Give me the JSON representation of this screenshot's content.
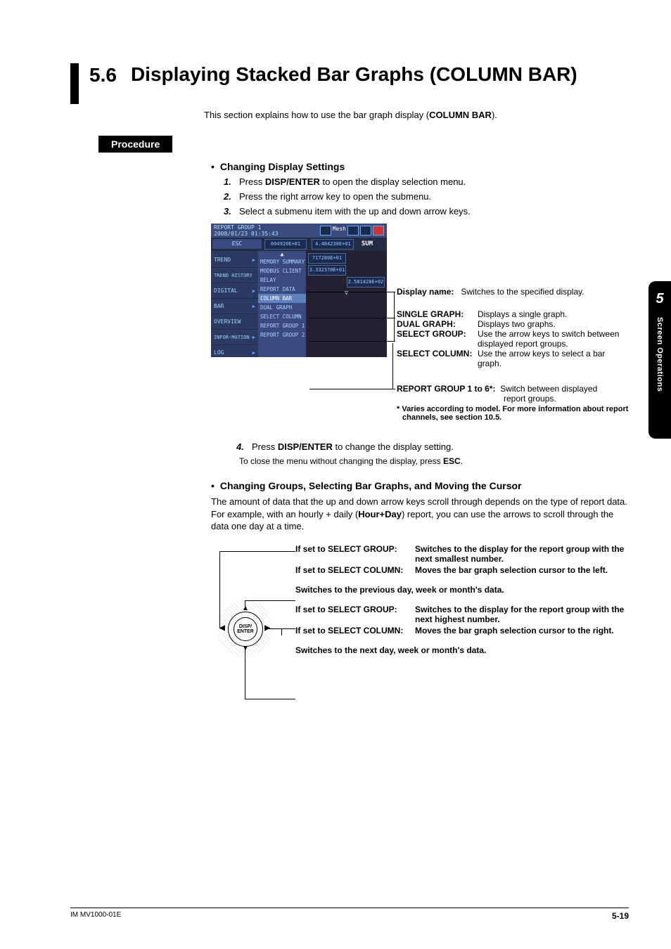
{
  "section": {
    "number": "5.6",
    "title": "Displaying Stacked Bar Graphs (COLUMN BAR)",
    "intro_prefix": "This section explains how to use the bar graph display (",
    "intro_bold": "COLUMN BAR",
    "intro_suffix": ")."
  },
  "procedure_label": "Procedure",
  "subsection1": {
    "heading": "Changing Display Settings",
    "steps": {
      "s1_pre": "Press ",
      "s1_bold": "DISP/ENTER",
      "s1_post": " to open the display selection menu.",
      "s2": "Press the right arrow key to open the submenu.",
      "s3": "Select a submenu item with the up and down arrow keys."
    }
  },
  "device": {
    "top_left_line1": "REPORT GROUP 1",
    "top_left_line2": "2008/01/23 01:35:43",
    "top_right": "Mesh",
    "esc": "ESC",
    "sum": "SUM",
    "cells": [
      "004920E+01",
      "4.484230E+01",
      "717280E+01",
      "3.332370E+01",
      "2.581428E+02"
    ],
    "sidebar": [
      "TREND",
      "TREND HISTORY",
      "DIGITAL",
      "BAR",
      "OVERVIEW",
      "INFOR-MATION",
      "LOG"
    ],
    "submenu": [
      "MEMORY SUMMARY",
      "MODBUS CLIENT",
      "RELAY",
      "REPORT DATA",
      "COLUMN BAR",
      "DUAL GRAPH",
      "SELECT COLUMN",
      "REPORT GROUP 1",
      "REPORT GROUP 2"
    ]
  },
  "annotations": {
    "display_name_label": "Display name:",
    "display_name_desc": "Switches to the specified display.",
    "single_graph_label": "SINGLE GRAPH:",
    "single_graph_desc": "Displays a single graph.",
    "dual_graph_label": "DUAL GRAPH:",
    "dual_graph_desc": "Displays two graphs.",
    "select_group_label": "SELECT GROUP:",
    "select_group_desc": "Use the arrow keys to switch between displayed report groups.",
    "select_column_label": "SELECT COLUMN:",
    "select_column_desc": "Use the arrow keys to select a bar graph.",
    "report_group_label": "REPORT GROUP 1 to 6*:",
    "report_group_desc1": "Switch between displayed",
    "report_group_desc2": "report groups.",
    "footnote1": "* Varies according to model. For more information about report",
    "footnote2": "channels, see section 10.5."
  },
  "step4": {
    "num": "4.",
    "pre": "Press ",
    "bold": "DISP/ENTER",
    "post": " to change the display setting.",
    "close_pre": "To close the menu without changing the display, press ",
    "close_bold": "ESC",
    "close_post": "."
  },
  "subsection2": {
    "heading": "Changing Groups, Selecting Bar Graphs, and Moving the Cursor",
    "para_pre": "The amount of data that the up and down arrow keys scroll through depends on the type of report data. For example, with an hourly + daily (",
    "para_bold": "Hour+Day",
    "para_post": ") report, you can use the arrows to scroll through the data one day at a time."
  },
  "dpad": {
    "center1": "DISP/",
    "center2": "ENTER",
    "left": {
      "l1_label": "If set to SELECT GROUP:",
      "l1_desc": "Switches to the display for the report group with the next smallest number.",
      "l2_label": "If set to SELECT COLUMN:",
      "l2_desc": "Moves the bar graph selection cursor to the left."
    },
    "up": "Switches to the previous day, week or month's data.",
    "right": {
      "r1_label": "If set to SELECT GROUP:",
      "r1_desc": "Switches to the display for the report group with the next highest number.",
      "r2_label": "If set to SELECT COLUMN:",
      "r2_desc": "Moves the bar graph selection cursor to the right."
    },
    "down": "Switches to the next day, week or month's data."
  },
  "sidetab": {
    "num": "5",
    "text": "Screen Operations"
  },
  "footer": {
    "left": "IM MV1000-01E",
    "right": "5-19"
  }
}
